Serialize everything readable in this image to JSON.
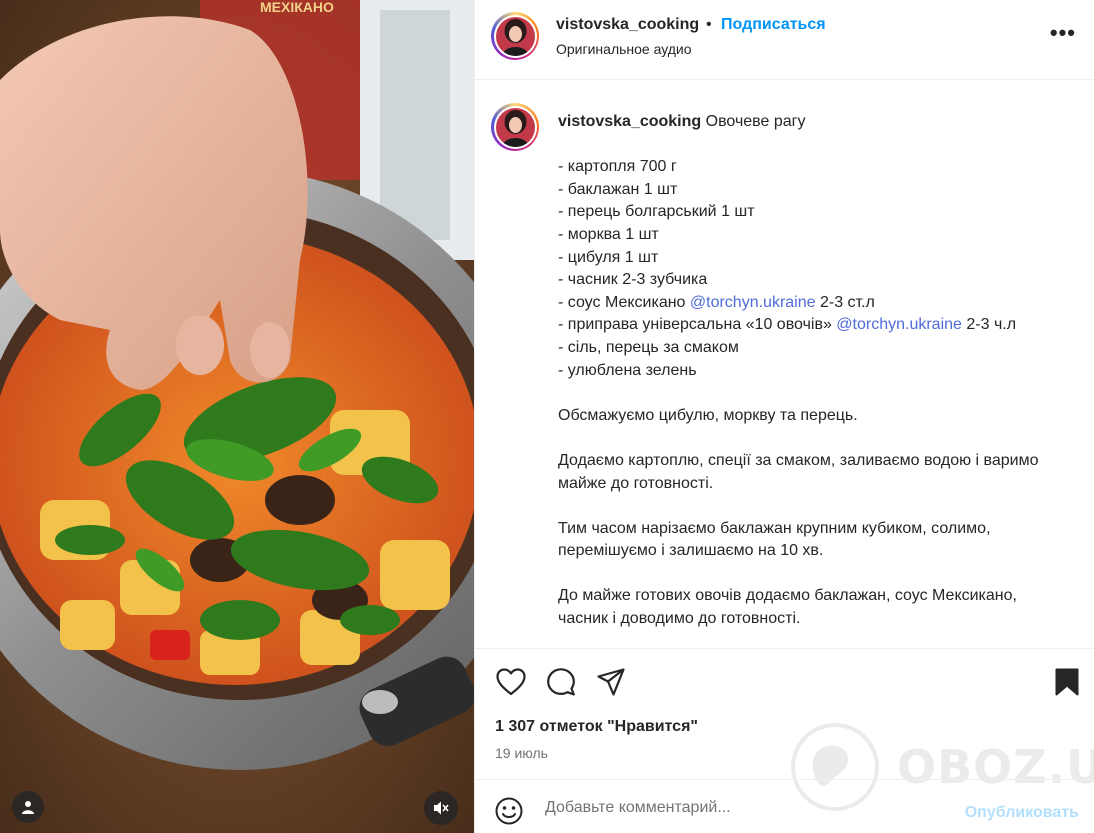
{
  "post": {
    "username": "vistovska_cooking",
    "separator": "•",
    "follow_label": "Подписаться",
    "audio_label": "Оригинальное аудио",
    "more_label": "•••"
  },
  "caption": {
    "username": "vistovska_cooking",
    "title": "Овочеве рагу",
    "ingredients": [
      "- картопля 700 г",
      "- баклажан 1 шт",
      "- перець болгарський 1 шт",
      "- морква 1 шт",
      "- цибуля 1 шт",
      "- часник 2-3 зубчика"
    ],
    "sauce_pre": "- соус Мексикано ",
    "sauce_mention": "@torchyn.ukraine",
    "sauce_post": " 2-3 ст.л",
    "spice_pre": "- приправа універсальна «10 овочів» ",
    "spice_mention": "@torchyn.ukraine",
    "spice_post": " 2-3 ч.л",
    "tail_ingredients": [
      "- сіль, перець за смаком",
      "- улюблена зелень"
    ],
    "step1": "Обсмажуємо цибулю, моркву та перець.",
    "step2_l1": "Додаємо картоплю, спеції за смаком, заливаємо водою і варимо",
    "step2_l2": "майже до готовності.",
    "step3_l1": "Тим часом нарізаємо баклажан крупним кубиком, солимо,",
    "step3_l2": "перемішуємо і залишаємо на 10 хв.",
    "step4_l1": "До майже готових овочів додаємо баклажан, соус Мексикано,",
    "step4_l2": "часник і доводимо до готовності."
  },
  "actions": {
    "likes": "1 307 отметок \"Нравится\"",
    "date": "19 июль"
  },
  "comment": {
    "placeholder": "Добавьте комментарий...",
    "post_label": "Опубликовать"
  },
  "media": {
    "package_text": "МЕХІКАНО"
  },
  "watermark": {
    "text": "OBOZ.UA"
  },
  "colors": {
    "accent": "#0095f6",
    "mention": "#4f6cd8",
    "post_disabled": "#b2dffc",
    "text": "#262626",
    "muted": "#737373"
  }
}
